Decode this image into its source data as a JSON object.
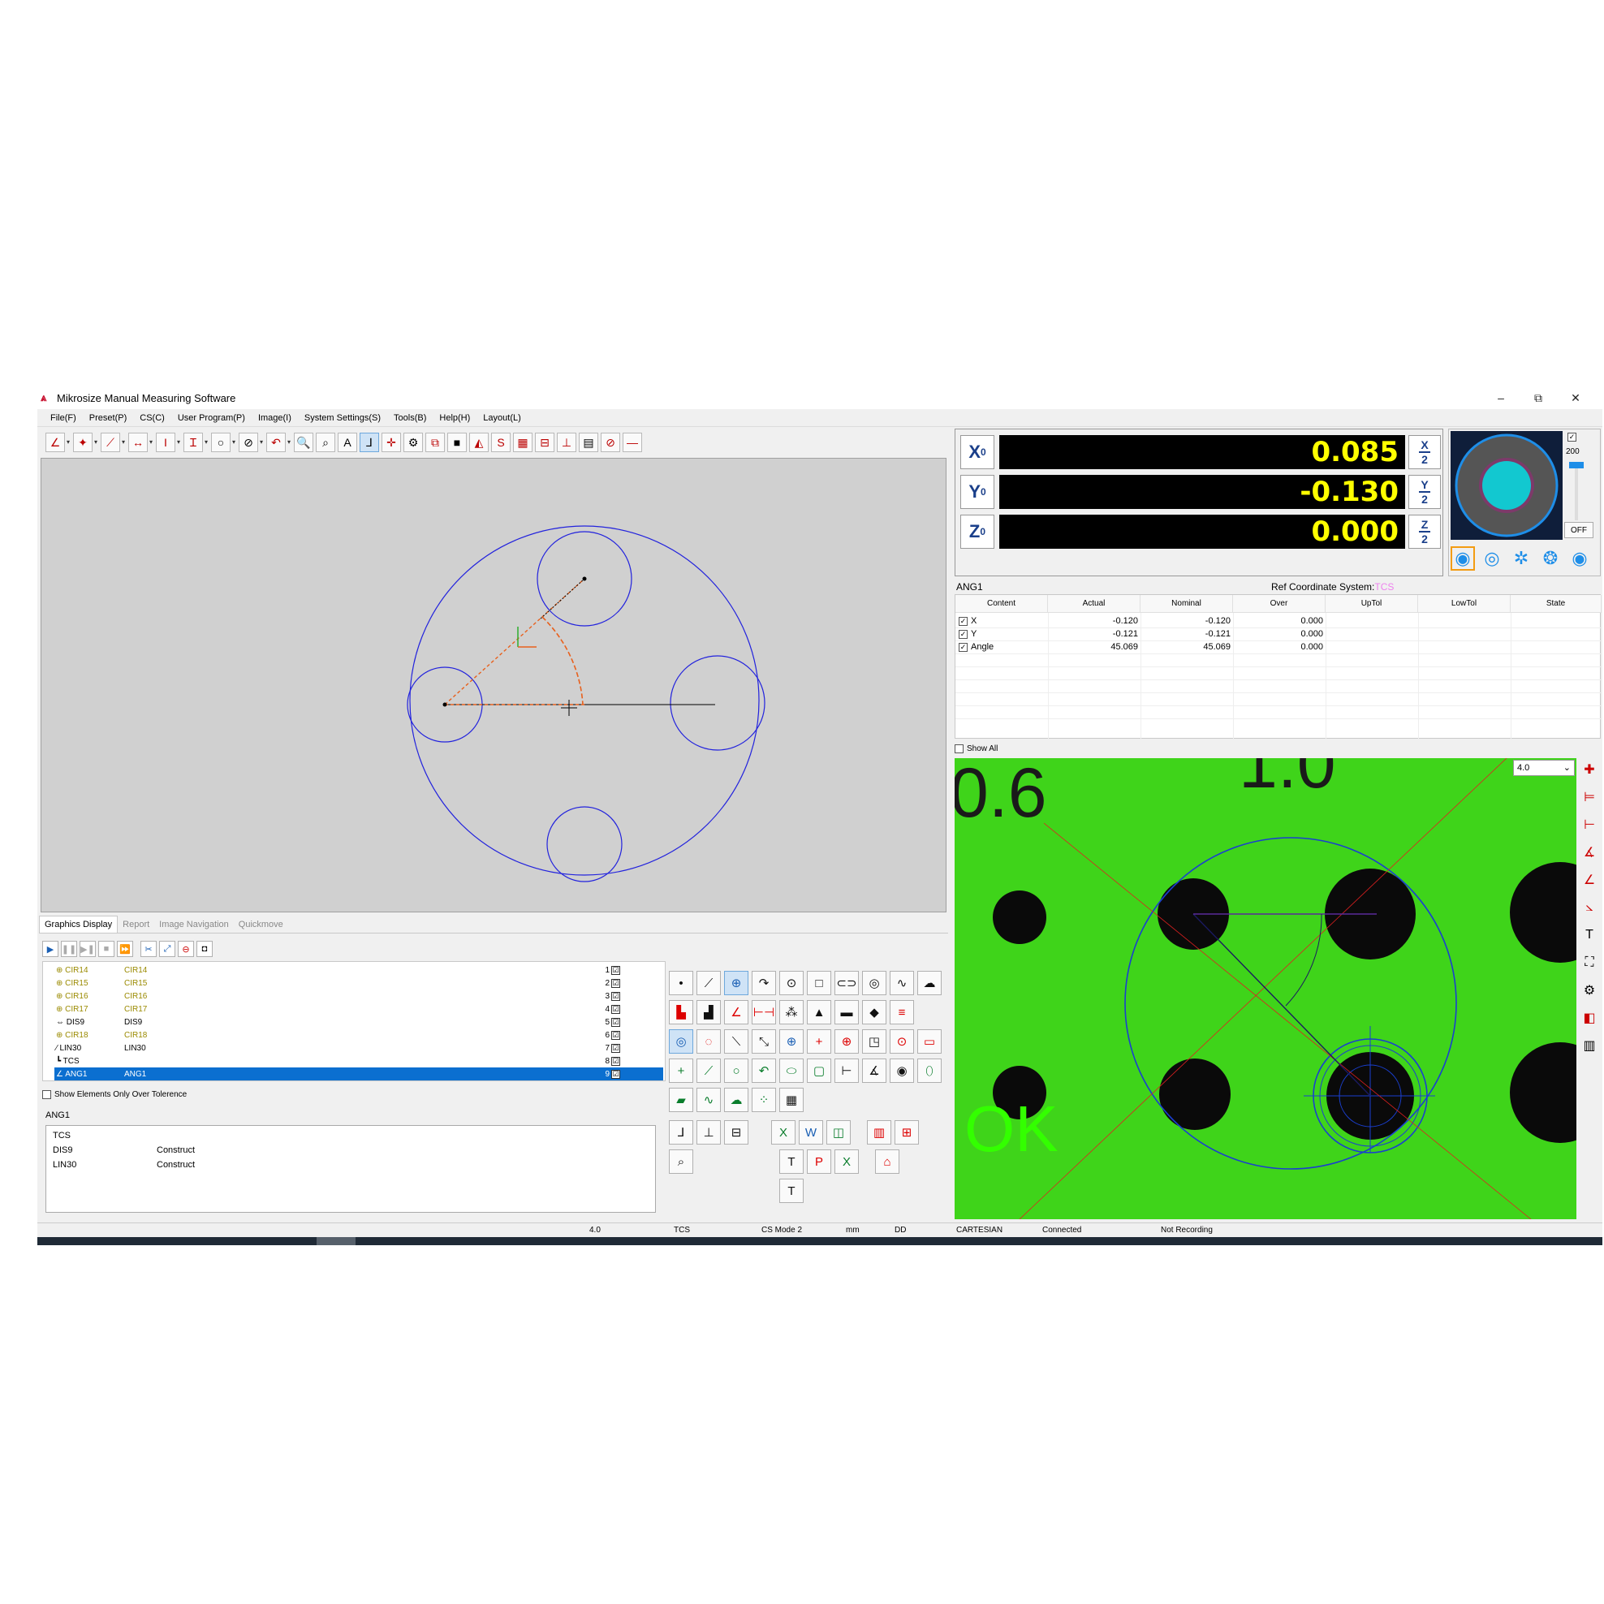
{
  "window": {
    "title": "Mikrosize Manual Measuring Software",
    "controls": {
      "minimize": "–",
      "restore": "⧉",
      "close": "✕"
    }
  },
  "menu": [
    "File(F)",
    "Preset(P)",
    "CS(C)",
    "User Program(P)",
    "Image(I)",
    "System Settings(S)",
    "Tools(B)",
    "Help(H)",
    "Layout(L)"
  ],
  "tabs": [
    "Graphics Display",
    "Report",
    "Image Navigation",
    "Quickmove"
  ],
  "elements": [
    {
      "name": "CIR14",
      "label": "CIR14",
      "index": "1",
      "checked": "☑",
      "olive": true,
      "icon": "⊕"
    },
    {
      "name": "CIR15",
      "label": "CIR15",
      "index": "2",
      "checked": "☑",
      "olive": true,
      "icon": "⊕"
    },
    {
      "name": "CIR16",
      "label": "CIR16",
      "index": "3",
      "checked": "☑",
      "olive": true,
      "icon": "⊕"
    },
    {
      "name": "CIR17",
      "label": "CIR17",
      "index": "4",
      "checked": "☑",
      "olive": true,
      "icon": "⊕"
    },
    {
      "name": "DIS9",
      "label": "DIS9",
      "index": "5",
      "checked": "☑",
      "olive": false,
      "icon": "⇔"
    },
    {
      "name": "CIR18",
      "label": "CIR18",
      "index": "6",
      "checked": "☑",
      "olive": true,
      "icon": "⊕"
    },
    {
      "name": "LIN30",
      "label": "LIN30",
      "index": "7",
      "checked": "☑",
      "olive": false,
      "icon": "⁄"
    },
    {
      "name": "TCS",
      "label": "",
      "index": "8",
      "checked": "☑",
      "olive": false,
      "icon": "┗"
    },
    {
      "name": "ANG1",
      "label": "ANG1",
      "index": "9",
      "checked": "☑",
      "olive": false,
      "icon": "∠"
    }
  ],
  "show_tolerance_label": "Show Elements Only Over Tolerence",
  "detail": {
    "title": "ANG1",
    "rows": [
      {
        "name": "TCS",
        "type": ""
      },
      {
        "name": "DIS9",
        "type": "Construct"
      },
      {
        "name": "LIN30",
        "type": "Construct"
      }
    ]
  },
  "dro": {
    "x": {
      "axis": "X",
      "value": "0.085"
    },
    "y": {
      "axis": "Y",
      "value": "-0.130"
    },
    "z": {
      "axis": "Z",
      "value": "0.000"
    },
    "axis_subscript": "0",
    "half_den": "2"
  },
  "light": {
    "value": "200",
    "off_label": "OFF"
  },
  "results": {
    "element": "ANG1",
    "ref_label": "Ref Coordinate System:",
    "ref_value": "TCS",
    "columns": [
      "Content",
      "Actual",
      "Nominal",
      "Over",
      "UpTol",
      "LowTol",
      "State"
    ],
    "rows": [
      {
        "content": "X",
        "actual": "-0.120",
        "nominal": "-0.120",
        "over": "0.000"
      },
      {
        "content": "Y",
        "actual": "-0.121",
        "nominal": "-0.121",
        "over": "0.000"
      },
      {
        "content": "Angle",
        "actual": "45.069",
        "nominal": "45.069",
        "over": "0.000"
      }
    ]
  },
  "show_all_label": "Show All",
  "camera": {
    "zoom": "4.0",
    "scale_marks": [
      "0.6",
      "1.0"
    ],
    "ok_text": "OK"
  },
  "status": {
    "zoom": "4.0",
    "cs": "TCS",
    "cs_mode": "CS Mode 2",
    "unit": "mm",
    "angle": "DD",
    "coord": "CARTESIAN",
    "conn": "Connected",
    "rec": "Not Recording"
  },
  "colors": {
    "graphics_bg": "#d0d0d0",
    "circle": "#2222dd",
    "arc": "#e8601c",
    "dro_text": "#ffff00",
    "camera_bg": "#3fd41a",
    "selection": "#0b6fd0"
  }
}
